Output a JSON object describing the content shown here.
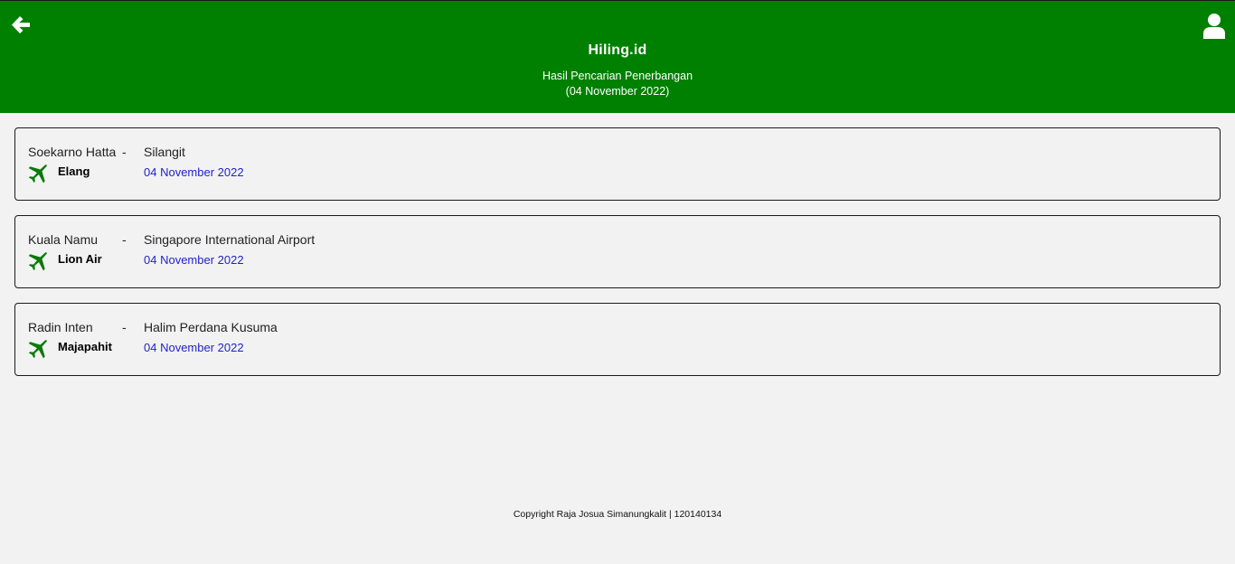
{
  "header": {
    "app_title": "Hiling.id",
    "subtitle_line1": "Hasil Pencarian Penerbangan",
    "subtitle_line2": "(04 November 2022)",
    "back_icon": "arrow-left-icon",
    "user_icon": "user-icon"
  },
  "flights": [
    {
      "origin": "Soekarno Hatta",
      "separator": "-",
      "destination": "Silangit",
      "airline": "Elang",
      "date": "04 November 2022",
      "icon": "plane-icon"
    },
    {
      "origin": "Kuala Namu",
      "separator": "-",
      "destination": "Singapore International Airport",
      "airline": "Lion Air",
      "date": "04 November 2022",
      "icon": "plane-icon"
    },
    {
      "origin": "Radin Inten",
      "separator": "-",
      "destination": "Halim Perdana Kusuma",
      "airline": "Majapahit",
      "date": "04 November 2022",
      "icon": "plane-icon"
    }
  ],
  "footer": {
    "copyright": "Copyright Raja Josua Simanungkalit | 120140134"
  },
  "colors": {
    "header_bg": "#008000",
    "page_bg": "#f2f2f2",
    "date_text": "#2222cc",
    "plane_icon": "#0a7a0a"
  }
}
